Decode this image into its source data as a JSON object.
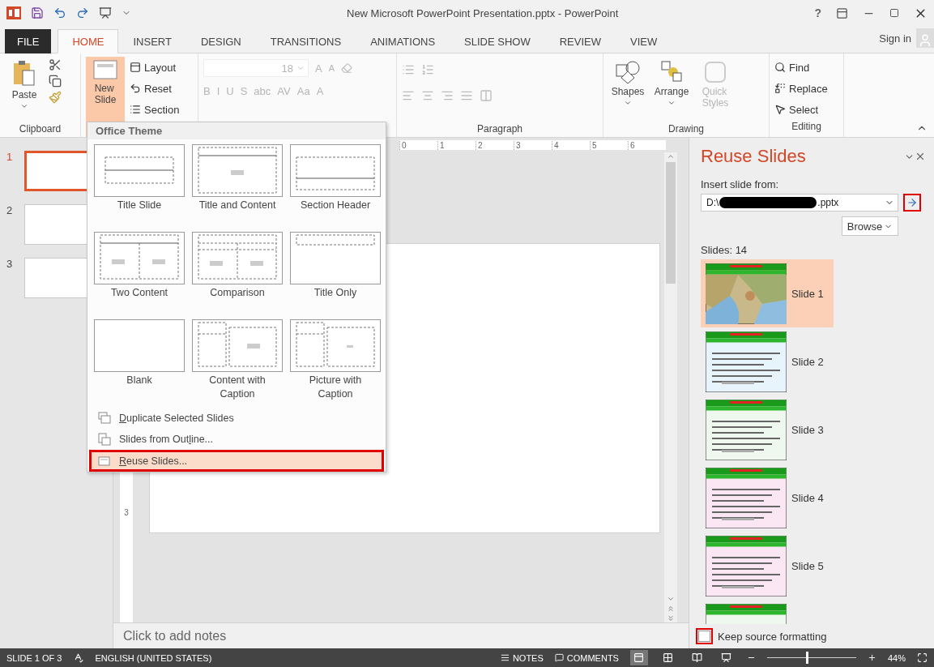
{
  "title_bar": {
    "title": "New Microsoft PowerPoint Presentation.pptx - PowerPoint",
    "help": "?"
  },
  "ribbon_tabs": [
    {
      "label": "FILE",
      "kind": "file",
      "selected": false
    },
    {
      "label": "HOME",
      "kind": "tab",
      "selected": true
    },
    {
      "label": "INSERT",
      "kind": "tab",
      "selected": false
    },
    {
      "label": "DESIGN",
      "kind": "tab",
      "selected": false
    },
    {
      "label": "TRANSITIONS",
      "kind": "tab",
      "selected": false
    },
    {
      "label": "ANIMATIONS",
      "kind": "tab",
      "selected": false
    },
    {
      "label": "SLIDE SHOW",
      "kind": "tab",
      "selected": false
    },
    {
      "label": "REVIEW",
      "kind": "tab",
      "selected": false
    },
    {
      "label": "VIEW",
      "kind": "tab",
      "selected": false
    }
  ],
  "sign_in": "Sign in",
  "ribbon": {
    "clipboard": {
      "paste": "Paste",
      "label": "Clipboard"
    },
    "slides": {
      "new_slide": "New",
      "new_slide_2": "Slide",
      "pressed": true,
      "layout": "Layout",
      "reset": "Reset",
      "section": "Section"
    },
    "font": {
      "disabled": true,
      "size": "18",
      "grow": "A",
      "shrink": "A",
      "buttons": [
        "B",
        "I",
        "U",
        "S",
        "abc",
        "AV",
        "Aa",
        "A"
      ]
    },
    "paragraph": {
      "disabled": true,
      "label": "Paragraph"
    },
    "drawing": {
      "shapes": "Shapes",
      "arrange": "Arrange",
      "quick_styles": "Quick",
      "quick_styles_2": "Styles",
      "quick_disabled": true,
      "label": "Drawing"
    },
    "editing": {
      "find": "Find",
      "replace": "Replace",
      "select": "Select",
      "label": "Editing"
    }
  },
  "new_slide_menu": {
    "header": "Office Theme",
    "layouts": [
      {
        "label": "Title Slide",
        "kind": "title"
      },
      {
        "label": "Title and Content",
        "kind": "content"
      },
      {
        "label": "Section Header",
        "kind": "section"
      },
      {
        "label": "Two Content",
        "kind": "two"
      },
      {
        "label": "Comparison",
        "kind": "comparison"
      },
      {
        "label": "Title Only",
        "kind": "titleonly"
      },
      {
        "label": "Blank",
        "kind": "blank"
      },
      {
        "label": "Content with Caption",
        "kind": "contentcaption"
      },
      {
        "label": "Picture with Caption",
        "kind": "picturecaption"
      }
    ],
    "items": [
      {
        "kind": "duplicate",
        "key": "D",
        "post": "uplicate Selected Slides",
        "highlighted": false
      },
      {
        "kind": "outline",
        "pre": "Slides from Out",
        "key": "l",
        "post": "ine...",
        "highlighted": false
      },
      {
        "kind": "reuse",
        "key": "R",
        "post": "euse Slides...",
        "highlighted": true
      }
    ]
  },
  "thumbnails": [
    {
      "number": "1",
      "selected": true
    },
    {
      "number": "2",
      "selected": false
    },
    {
      "number": "3",
      "selected": false
    }
  ],
  "ruler": [
    "0",
    "1",
    "2",
    "3",
    "4",
    "5",
    "6"
  ],
  "vertical_ruler": [
    "3"
  ],
  "notes": {
    "placeholder": "Click to add notes"
  },
  "reuse_pane": {
    "title": "Reuse Slides",
    "insert_label": "Insert slide from:",
    "path_start": "D:\\",
    "path_end": ".pptx",
    "go_highlighted": true,
    "browse": "Browse",
    "count": "Slides: 14",
    "slides": [
      {
        "label": "Slide 1",
        "kind": "map",
        "selected": true
      },
      {
        "label": "Slide 2",
        "kind": "blue",
        "selected": false
      },
      {
        "label": "Slide 3",
        "kind": "green",
        "selected": false
      },
      {
        "label": "Slide 4",
        "kind": "pink",
        "selected": false
      },
      {
        "label": "Slide 5",
        "kind": "pink",
        "selected": false
      },
      {
        "kind": "green",
        "selected": false
      }
    ],
    "keep_formatting": {
      "label": "Keep source formatting",
      "checked": false,
      "highlighted": true
    }
  },
  "status_bar": {
    "slide": "SLIDE 1 OF 3",
    "language": "ENGLISH (UNITED STATES)",
    "notes": "NOTES",
    "comments": "COMMENTS",
    "views": [
      {
        "kind": "normal",
        "selected": true
      },
      {
        "kind": "sorter",
        "selected": false
      },
      {
        "kind": "reading",
        "selected": false
      },
      {
        "kind": "show",
        "selected": false
      }
    ],
    "zoom": {
      "level": 0.45
    },
    "zoom_text": "44%"
  }
}
